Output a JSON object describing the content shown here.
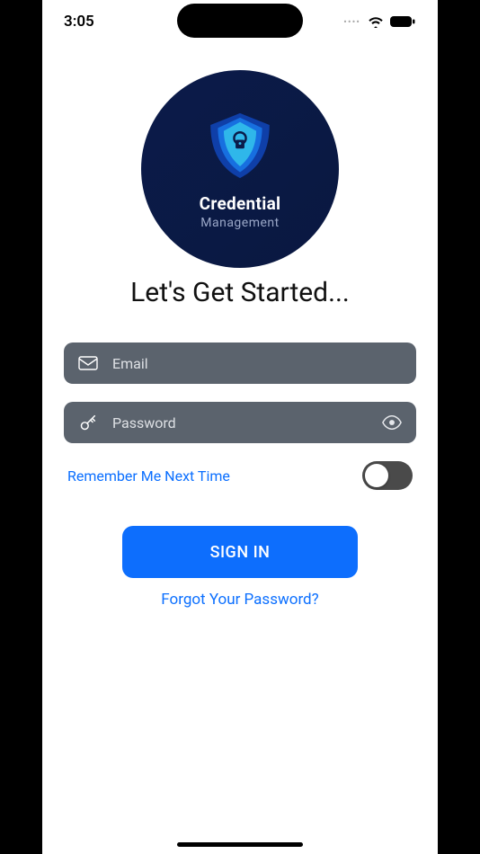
{
  "status": {
    "time": "3:05"
  },
  "logo": {
    "title": "Credential",
    "subtitle": "Management"
  },
  "heading": "Let's Get Started...",
  "form": {
    "email": {
      "placeholder": "Email",
      "value": ""
    },
    "password": {
      "placeholder": "Password",
      "value": ""
    },
    "remember_label": "Remember Me Next Time",
    "remember_value": false,
    "signin_label": "SIGN IN",
    "forgot_label": "Forgot Your Password?"
  },
  "colors": {
    "accent": "#0d6efd",
    "link": "#0b6fff",
    "input_bg": "#5b636d",
    "logo_bg": "#0b1b4a"
  }
}
